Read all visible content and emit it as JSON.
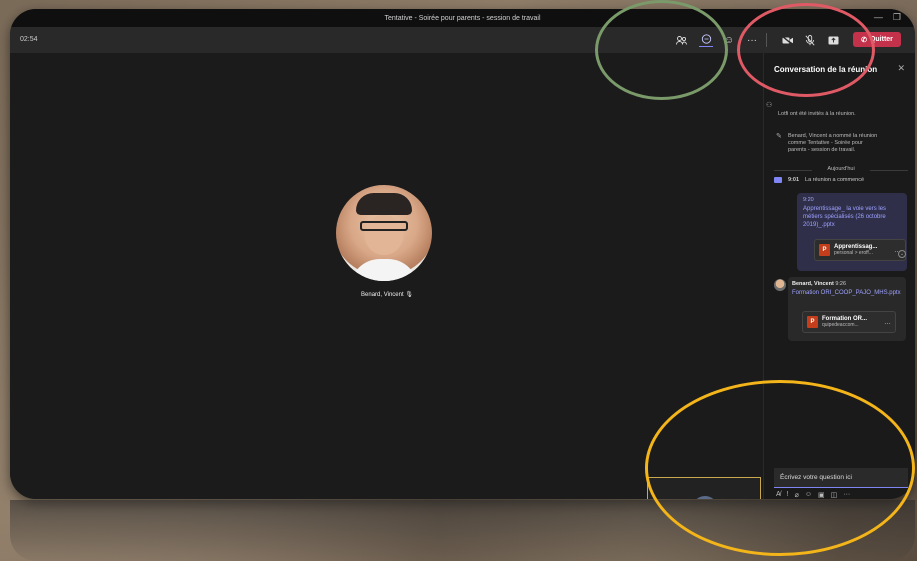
{
  "window": {
    "title": "Tentative - Soirée pour parents - session de travail"
  },
  "toolbar": {
    "timer": "02:54",
    "quit_label": "Quitter"
  },
  "stage": {
    "participant_name": "Benard, Vincent",
    "self_more": "..."
  },
  "chat": {
    "header": "Conversation de la réunion",
    "sys_msgs": [
      "Lotfi ont été invités à la réunion.",
      "Benard, Vincent a nommé la réunion comme Tentative - Soirée pour parents - session de travail."
    ],
    "day_divider": "Aujourd'hui",
    "meeting_start_time": "9:01",
    "meeting_start_text": "La réunion a commencé",
    "my_message": {
      "time": "9:20",
      "link": "Apprentissage_ la voie vers les métiers spécialisés (26 octobre 2019)_.pptx",
      "file_name": "Apprentissag...",
      "file_path": "personal > eroff..."
    },
    "other_message": {
      "author": "Benard, Vincent",
      "time": "9:26",
      "link": "Formation ORI_COOP_PAJO_MHS.pptx",
      "file_name": "Formation OR...",
      "file_path": "quipedeaccom..."
    },
    "compose_placeholder": "Écrivez votre question ici"
  },
  "colors": {
    "accent": "#7f85f5",
    "quit_red": "#c4314b",
    "annot_green": "#7a9a6a",
    "annot_red": "#e05a66",
    "annot_yellow": "#f3b51a"
  }
}
